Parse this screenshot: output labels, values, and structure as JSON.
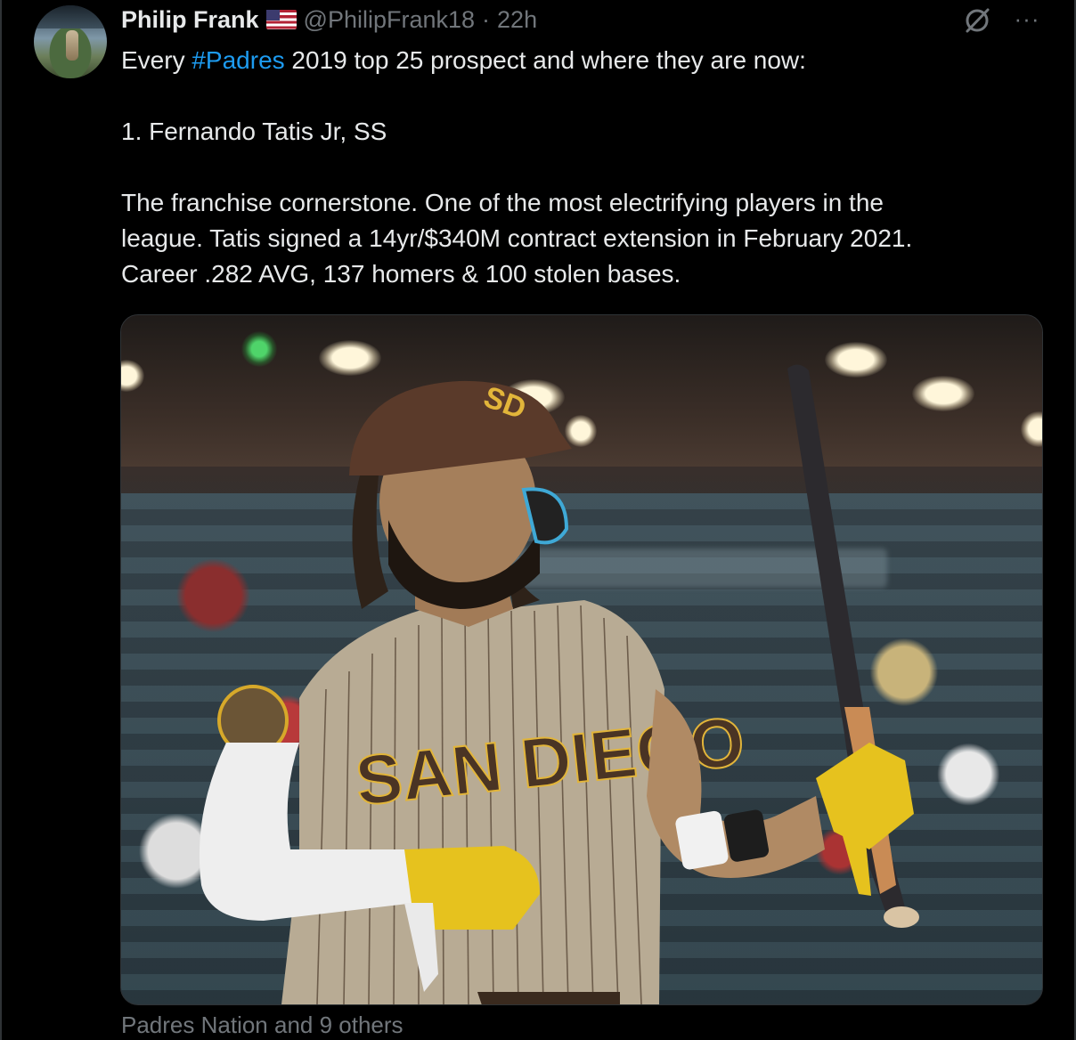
{
  "author": {
    "name": "Philip Frank",
    "flag": "us-flag-emoji",
    "handle": "@PhilipFrank18",
    "separator": "·",
    "time": "22h"
  },
  "tweet": {
    "line1_prefix": "Every ",
    "hashtag": "#Padres",
    "line1_suffix": " 2019 top 25 prospect and where they are now:",
    "line2": "1. Fernando Tatis Jr, SS",
    "line3": "The franchise cornerstone. One of the most electrifying players in the",
    "line4": "league. Tatis signed a 14yr/$340M contract extension in February 2021.",
    "line5": "Career .282 AVG, 137 homers & 100 stolen bases."
  },
  "media": {
    "jersey_text": "SAN DIEGO",
    "helmet_logo": "SD"
  },
  "icons": {
    "grok": "grok-icon",
    "more": "more-icon"
  },
  "more_symbol": "···",
  "social_context": "Padres Nation and 9 others",
  "colors": {
    "background": "#000000",
    "text": "#e7e9ea",
    "secondary_text": "#71767b",
    "link": "#1d9bf0",
    "border": "#2f3336"
  }
}
